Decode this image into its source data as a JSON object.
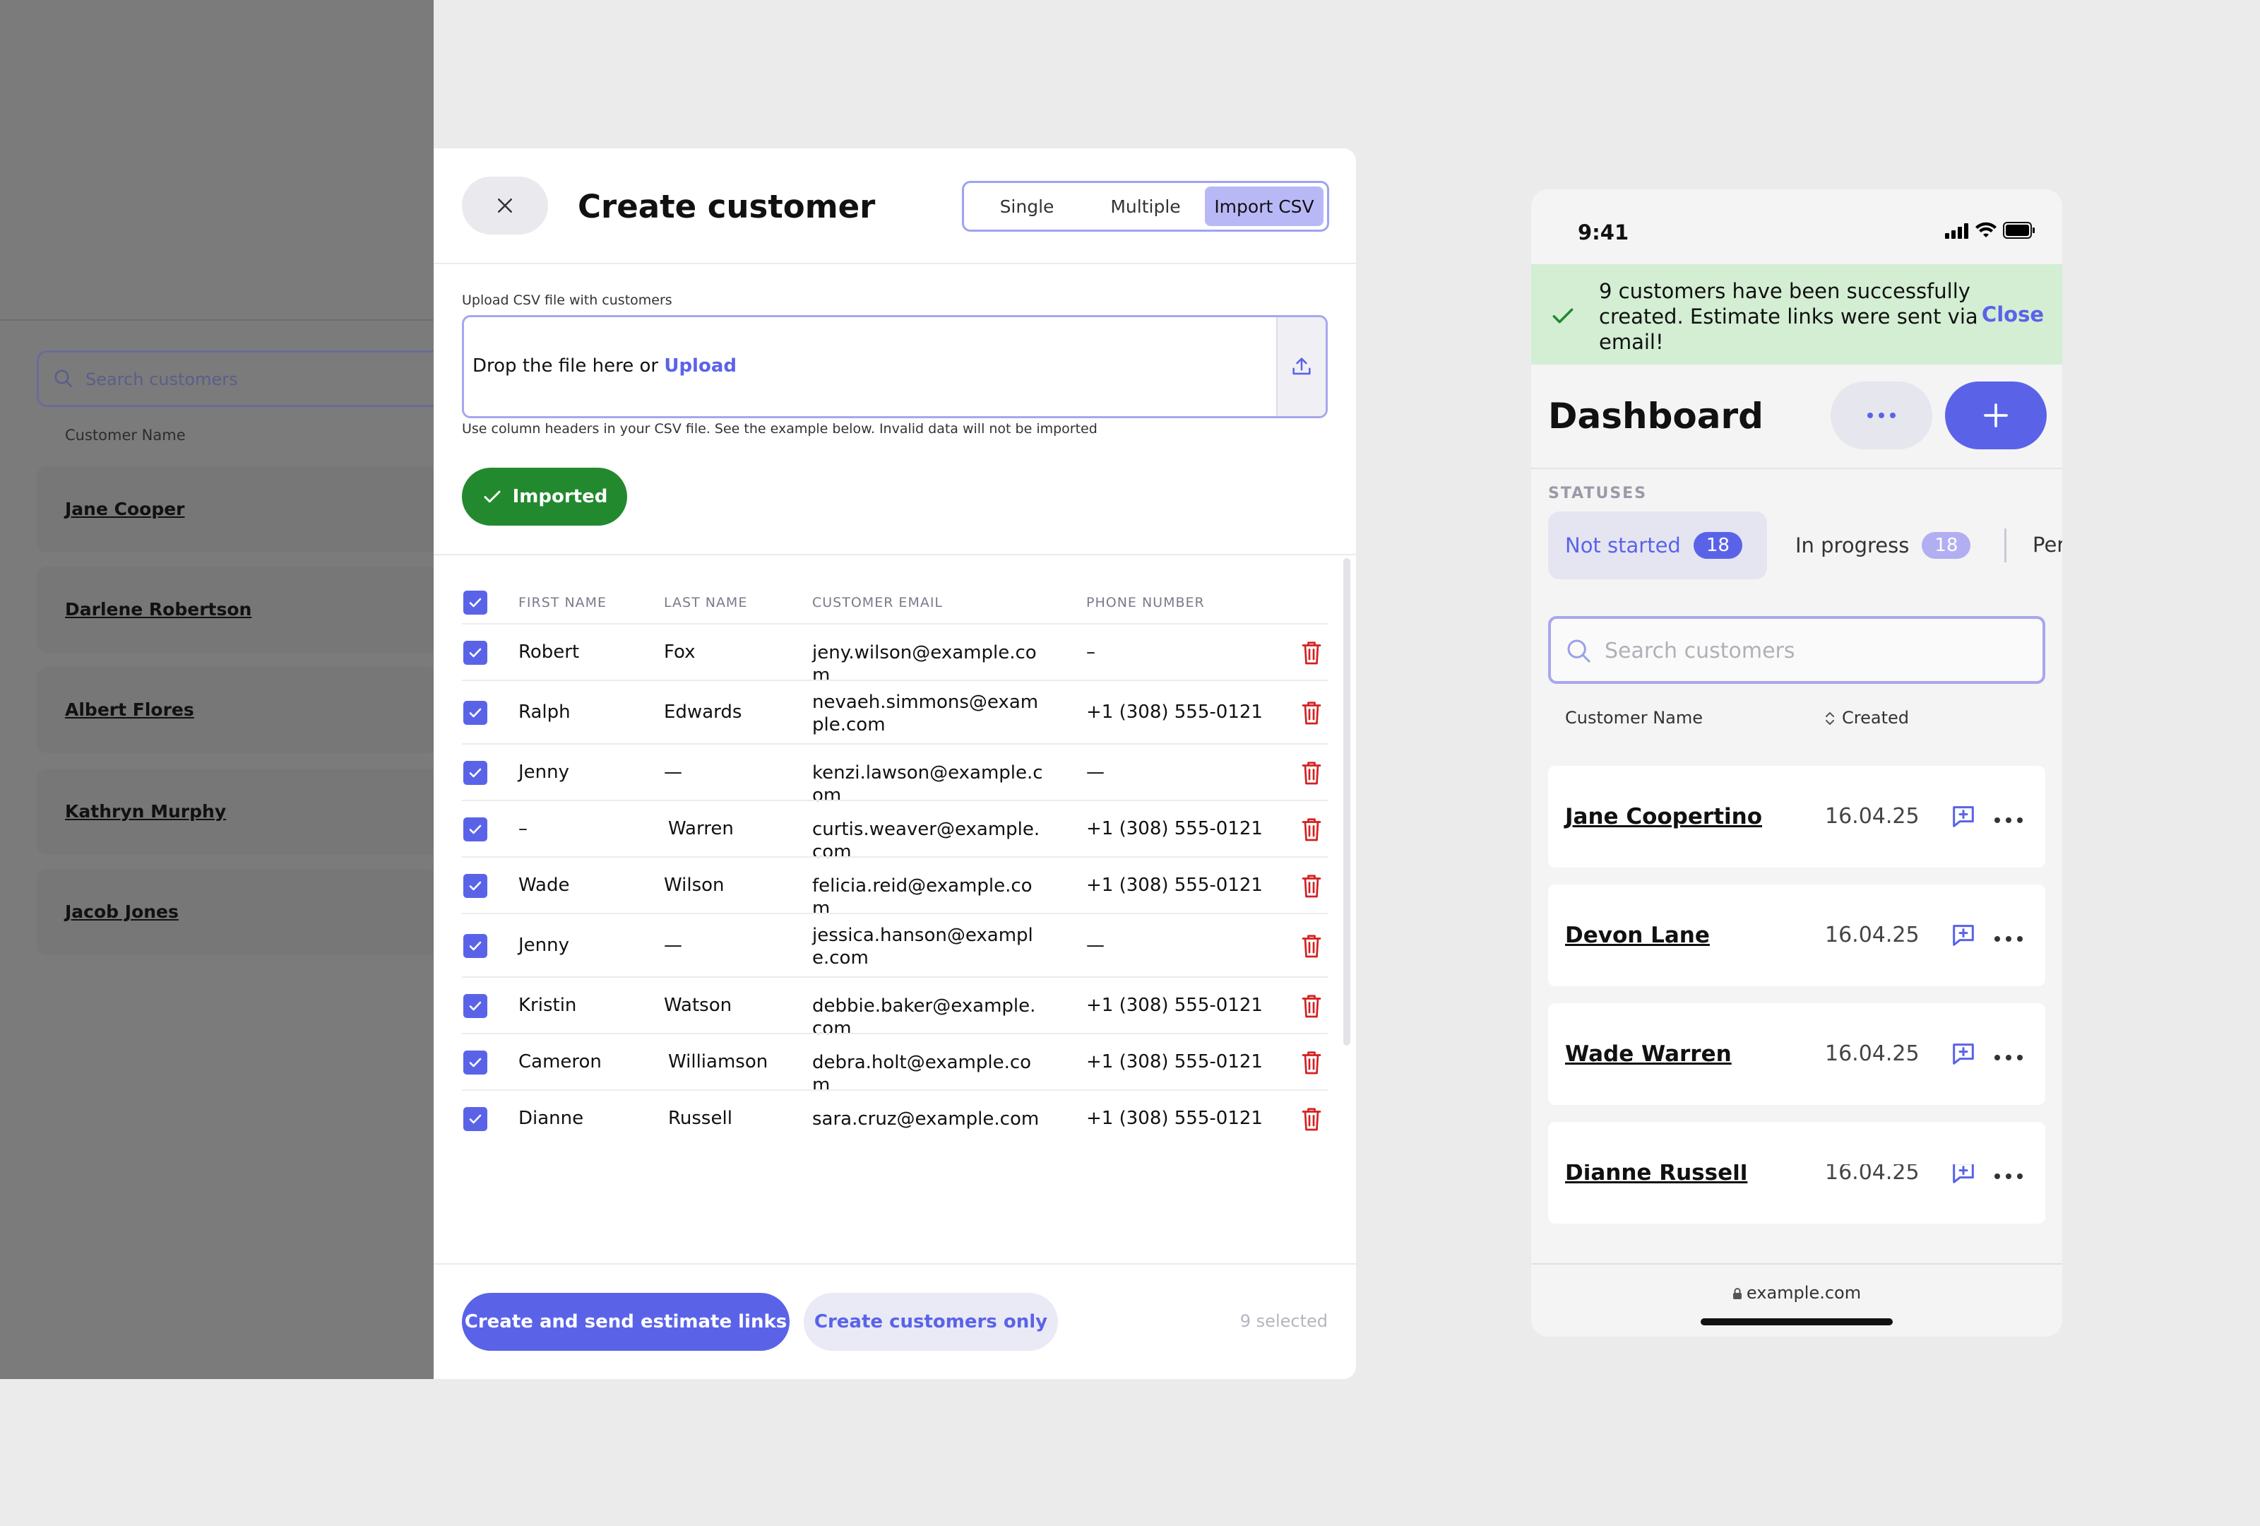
{
  "background_list": {
    "search_placeholder": "Search customers",
    "column_header": "Customer Name",
    "rows": [
      "Jane Cooper",
      "Darlene Robertson",
      "Albert Flores",
      "Kathryn Murphy",
      "Jacob Jones"
    ]
  },
  "modal": {
    "title": "Create customer",
    "tabs": [
      "Single",
      "Multiple",
      "Import CSV"
    ],
    "active_tab": "Import CSV",
    "upload_label": "Upload CSV file with customers",
    "drop_text": "Drop the file here or ",
    "upload_link": "Upload",
    "hint": "Use column headers in your CSV file. See the example below. Invalid data will not be imported",
    "imported_label": "Imported",
    "columns": [
      "FIRST NAME",
      "LAST NAME",
      "CUSTOMER EMAIL",
      "PHONE NUMBER"
    ],
    "rows": [
      {
        "first": "Robert",
        "last": "Fox",
        "email": "jeny.wilson@example.com",
        "phone": "–"
      },
      {
        "first": "Ralph",
        "last": "Edwards",
        "email": "nevaeh.simmons@example.com",
        "phone": "+1 (308) 555-0121"
      },
      {
        "first": "Jenny",
        "last": "—",
        "email": "kenzi.lawson@example.com",
        "phone": "—"
      },
      {
        "first": "–",
        "last": "Warren",
        "email": "curtis.weaver@example.com",
        "phone": "+1 (308) 555-0121"
      },
      {
        "first": "Wade",
        "last": "Wilson",
        "email": "felicia.reid@example.com",
        "phone": "+1 (308) 555-0121"
      },
      {
        "first": "Jenny",
        "last": "—",
        "email": "jessica.hanson@example.com",
        "phone": "—"
      },
      {
        "first": "Kristin",
        "last": "Watson",
        "email": "debbie.baker@example.com",
        "phone": "+1 (308) 555-0121"
      },
      {
        "first": "Cameron",
        "last": "Williamson",
        "email": "debra.holt@example.com",
        "phone": "+1 (308) 555-0121"
      },
      {
        "first": "Dianne",
        "last": "Russell",
        "email": "sara.cruz@example.com",
        "phone": "+1 (308) 555-0121"
      }
    ],
    "primary_button": "Create and send estimate links",
    "secondary_button": "Create customers only",
    "selected_count": "9 selected"
  },
  "phone": {
    "time": "9:41",
    "toast_text": "9 customers have been successfully created. Estimate links were sent via email!",
    "toast_close": "Close",
    "title": "Dashboard",
    "statuses_label": "STATUSES",
    "status_tabs": [
      {
        "label": "Not started",
        "count": "18"
      },
      {
        "label": "In progress",
        "count": "18"
      },
      {
        "label": "Per"
      }
    ],
    "search_placeholder": "Search customers",
    "col_name": "Customer Name",
    "col_created": "Created",
    "customers": [
      {
        "name": "Jane Coopertino",
        "date": "16.04.25"
      },
      {
        "name": "Devon Lane",
        "date": "16.04.25"
      },
      {
        "name": "Wade Warren",
        "date": "16.04.25"
      },
      {
        "name": "Dianne Russell",
        "date": "16.04.25"
      }
    ],
    "url": "example.com"
  },
  "colors": {
    "accent": "#5a63e8",
    "success": "#23892f",
    "danger": "#d32020",
    "toast_bg": "#d3eed3"
  }
}
